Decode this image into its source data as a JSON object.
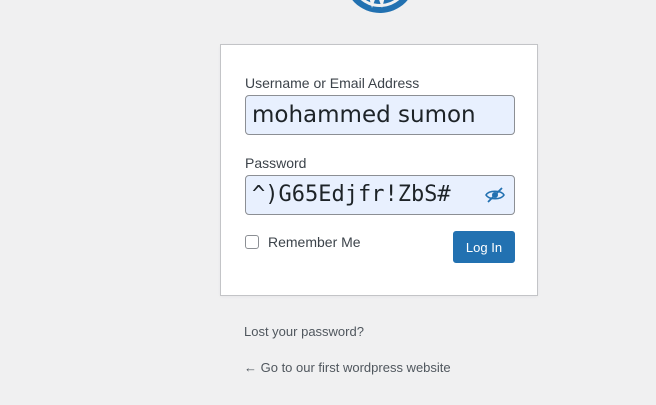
{
  "form": {
    "username_label": "Username or Email Address",
    "username_value": "mohammed sumon",
    "password_label": "Password",
    "password_value": "^)G65Edjfr!ZbS#",
    "remember_label": "Remember Me",
    "remember_checked": false,
    "submit_label": "Log In"
  },
  "links": {
    "lost_password": "Lost your password?",
    "back_to_site": "← Go to our first wordpress website"
  },
  "icons": {
    "logo": "wordpress-logo-icon",
    "toggle_password": "eye-slash-icon"
  },
  "colors": {
    "background": "#f0f0f1",
    "primary": "#2271b1",
    "input_fill": "#e8f0fe"
  }
}
